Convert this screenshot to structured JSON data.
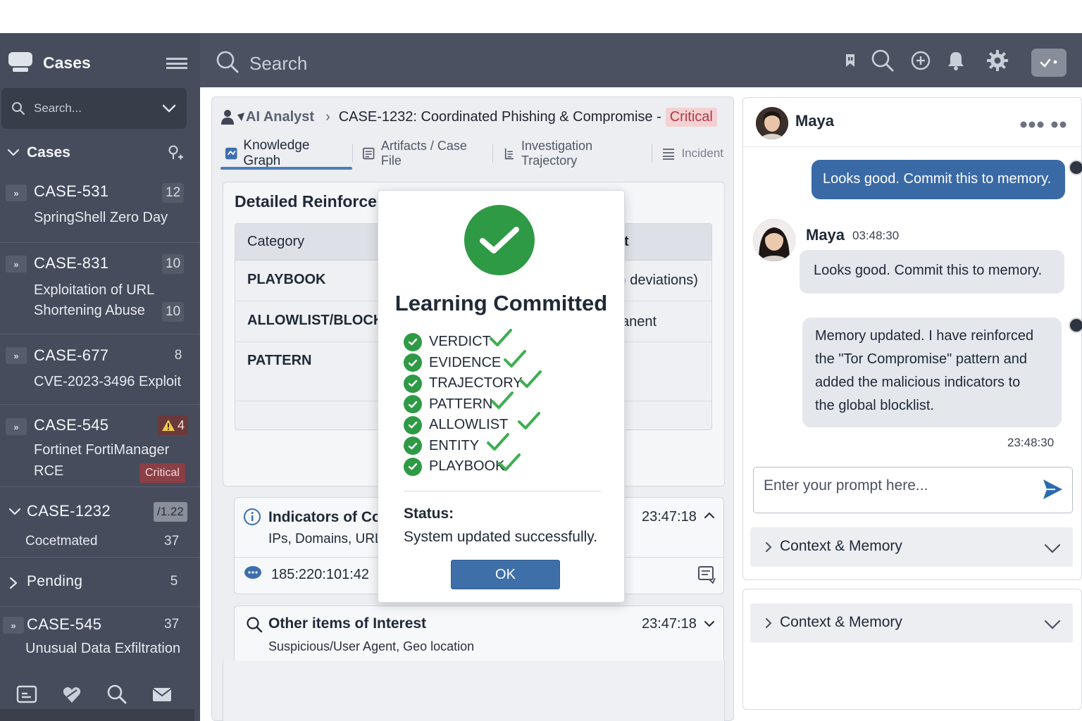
{
  "sidebar": {
    "title": "Cases",
    "search_placeholder": "Search...",
    "section_cases": "Cases",
    "items": [
      {
        "id": "CASE-531",
        "title": "SpringShell Zero Day",
        "count": "12"
      },
      {
        "id": "CASE-831",
        "title_line1": "Exploitation of URL",
        "title_line2": "Shortening Abuse",
        "count": "10",
        "count2": "10"
      },
      {
        "id": "CASE-677",
        "title": "CVE-2023-3496 Exploit",
        "count": "8"
      },
      {
        "id": "CASE-545",
        "title_line1": "Fortinet FortiManager",
        "title_line2": "RCE",
        "count": "4",
        "severity": "Critical"
      }
    ],
    "expanded_case": {
      "id": "CASE-1232",
      "tag": "/1.22",
      "sub_label": "Cocetmated",
      "sub_count": "37"
    },
    "pending": {
      "label": "Pending",
      "count": "5"
    },
    "last_item": {
      "id": "CASE-545",
      "title": "Unusual Data Exfiltration",
      "count": "37"
    },
    "footer_icons": [
      "card-icon",
      "heart-shield-icon",
      "search-icon",
      "mail-icon"
    ]
  },
  "topbar": {
    "search_placeholder": "Search",
    "icons": [
      "bookmark-icon",
      "search-icon",
      "add-circle-icon",
      "bell-icon",
      "gear-icon",
      "check-menu-icon"
    ]
  },
  "main": {
    "breadcrumb": {
      "analyst": "AI Analyst",
      "case": "CASE-1232: Coordinated Phishing & Compromise -",
      "severity": "Critical"
    },
    "tabs": [
      {
        "label": "Knowledge Graph",
        "active": true
      },
      {
        "label": "Artifacts / Case File"
      },
      {
        "label": "Investigation Trajectory"
      },
      {
        "label": "Incident"
      }
    ],
    "reinforcement": {
      "title": "Detailed Reinforcen",
      "header_col1": "Category",
      "header_col2": "t",
      "rows": [
        {
          "category": "PLAYBOOK",
          "detail": ") deviations)"
        },
        {
          "category": "ALLOWLIST/BLOCKL",
          "detail": "anent"
        },
        {
          "category": "PATTERN",
          "detail": ""
        }
      ]
    },
    "indicators": {
      "title": "Indicators of Con",
      "subtitle": "IPs, Domains, URL",
      "time": "23:47:18",
      "ip": "185:220:101:42"
    },
    "other_items": {
      "title": "Other items of Interest",
      "subtitle": "Suspicious/User Agent, Geo location",
      "time": "23:47:18"
    }
  },
  "modal": {
    "title": "Learning Committed",
    "items": [
      "VERDICT",
      "EVIDENCE",
      "TRAJECTORY",
      "PATTERN",
      "ALLOWLIST",
      "ENTITY",
      "PLAYBOOK"
    ],
    "status_label": "Status:",
    "status_value": "System updated successfully.",
    "ok_label": "OK",
    "accent": "#2f9a45"
  },
  "chat": {
    "user_name": "Maya",
    "messages": [
      {
        "from": "me",
        "text": "Looks good. Commit this to memory."
      },
      {
        "from": "Maya",
        "time": "03:48:30",
        "text": "Looks good. Commit this to memory."
      },
      {
        "from": "bot",
        "text_lines": [
          "Memory updated. I have reinforced",
          "the \"Tor Compromise\" pattern and",
          "added the malicious indicators to",
          "the global blocklist."
        ],
        "time": "23:48:30"
      }
    ],
    "prompt_placeholder": "Enter your prompt here...",
    "context_label": "Context & Memory",
    "context_label_2": "Context & Memory"
  },
  "colors": {
    "sidebar_bg": "#464c5b",
    "topbar_bg": "#4b5161",
    "primary_blue": "#3a6aa6",
    "critical_red": "#b03a44",
    "success_green": "#2f9a45"
  }
}
